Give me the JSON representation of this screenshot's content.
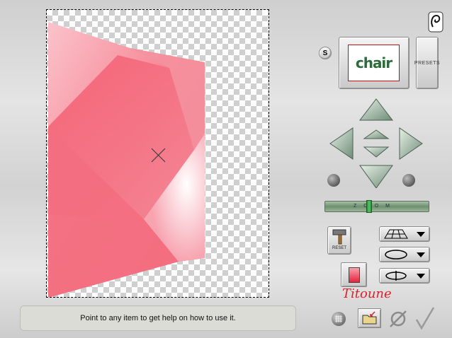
{
  "status": {
    "help_text": "Point to any item to get help on how to use it."
  },
  "preset": {
    "preview_text": "chair",
    "button_label": "PRESETS"
  },
  "toolbar": {
    "s_label": "S",
    "reset_label": "RESET"
  },
  "zoom": {
    "label": "ZOOM",
    "level": 0.42
  },
  "signature": "Titoune",
  "colors": {
    "shape_pink": "#f0566a",
    "light_pink": "#fbd6dc",
    "accent_red": "#e0202a"
  },
  "icons": {
    "app": "swirl-icon",
    "nav": [
      "arrow-up-icon",
      "arrow-left-icon",
      "arrow-right-icon",
      "arrow-down-icon",
      "arrow-up-small-icon",
      "arrow-down-small-icon"
    ],
    "tools": [
      "grid-perspective-icon",
      "ellipse-icon",
      "rotate-icon",
      "hammer-icon",
      "color-swatch-icon",
      "grid-icon",
      "folder-icon",
      "cancel-icon",
      "ok-check-icon"
    ]
  }
}
